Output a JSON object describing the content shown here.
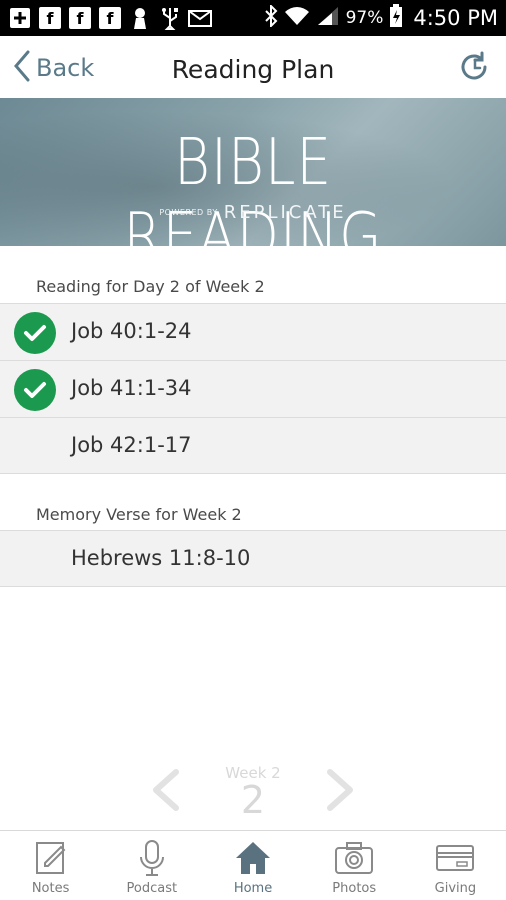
{
  "status_bar": {
    "notification_icons": [
      "plus-box-icon",
      "facebook-icon",
      "facebook-icon",
      "facebook-icon",
      "keyhole-icon",
      "usb-icon",
      "mail-icon"
    ],
    "notification_letters": {
      "facebook": "f"
    },
    "battery": "97%",
    "time": "4:50 PM"
  },
  "header": {
    "back_label": "Back",
    "title": "Reading Plan"
  },
  "banner": {
    "title": "BIBLE READING",
    "powered_by": "POWERED BY",
    "brand": "REPLICATE"
  },
  "reading": {
    "section_label": "Reading for Day 2 of Week 2",
    "items": [
      {
        "label": "Job 40:1-24",
        "completed": true
      },
      {
        "label": "Job 41:1-34",
        "completed": true
      },
      {
        "label": "Job 42:1-17",
        "completed": false
      }
    ]
  },
  "memory": {
    "section_label": "Memory Verse for Week 2",
    "items": [
      {
        "label": "Hebrews 11:8-10"
      }
    ]
  },
  "week_nav": {
    "caption": "Week 2",
    "number": "2"
  },
  "tabs": [
    {
      "label": "Notes",
      "icon": "notes-icon",
      "active": false
    },
    {
      "label": "Podcast",
      "icon": "microphone-icon",
      "active": false
    },
    {
      "label": "Home",
      "icon": "home-icon",
      "active": true
    },
    {
      "label": "Photos",
      "icon": "camera-icon",
      "active": false
    },
    {
      "label": "Giving",
      "icon": "credit-card-icon",
      "active": false
    }
  ],
  "colors": {
    "accent": "#5a7a8a",
    "check_green": "#1b9a4f",
    "row_bg": "#f2f2f2"
  }
}
